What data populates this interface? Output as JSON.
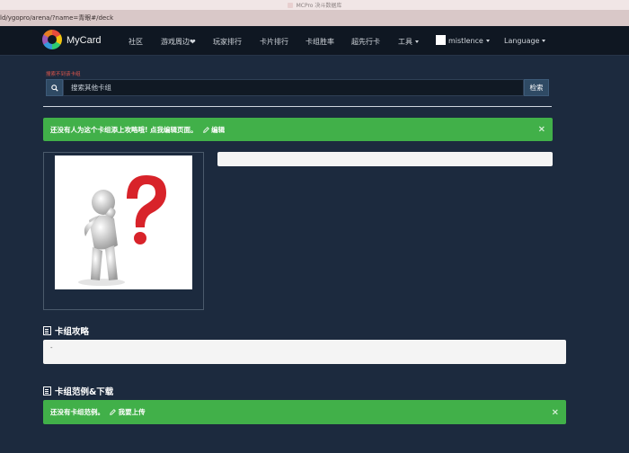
{
  "window": {
    "title": "MCPro 决斗数据库"
  },
  "browser": {
    "url": "ld/ygopro/arena/?name=青眼#/deck"
  },
  "navbar": {
    "brand": "MyCard",
    "items": [
      {
        "label": "社区"
      },
      {
        "label": "游戏周边❤"
      },
      {
        "label": "玩家排行"
      },
      {
        "label": "卡片排行"
      },
      {
        "label": "卡组胜率"
      },
      {
        "label": "超先行卡"
      }
    ],
    "tools_label": "工具",
    "user_label": "mistlence",
    "language_label": "Language"
  },
  "search": {
    "error": "搜索不到该卡组",
    "placeholder": "搜索其他卡组",
    "button_label": "检索"
  },
  "alert_strategy": {
    "text": "还没有人为这个卡组添上攻略哦! 点我编辑页面。",
    "edit_label": "编辑",
    "close": "×"
  },
  "sections": {
    "strategy_title": "卡组攻略",
    "strategy_content": "-",
    "examples_title": "卡组范例&下载"
  },
  "alert_examples": {
    "text": "还没有卡组范例。",
    "upload_label": "我要上传",
    "close": "×"
  },
  "colors": {
    "background": "#1c2a3e",
    "navbar": "#0f1722",
    "success": "#41b049",
    "danger": "#e2574c",
    "question_mark": "#d8232a"
  },
  "icons": {
    "search": "search-icon",
    "edit": "pencil-icon",
    "section": "document-icon",
    "close": "close-icon"
  }
}
